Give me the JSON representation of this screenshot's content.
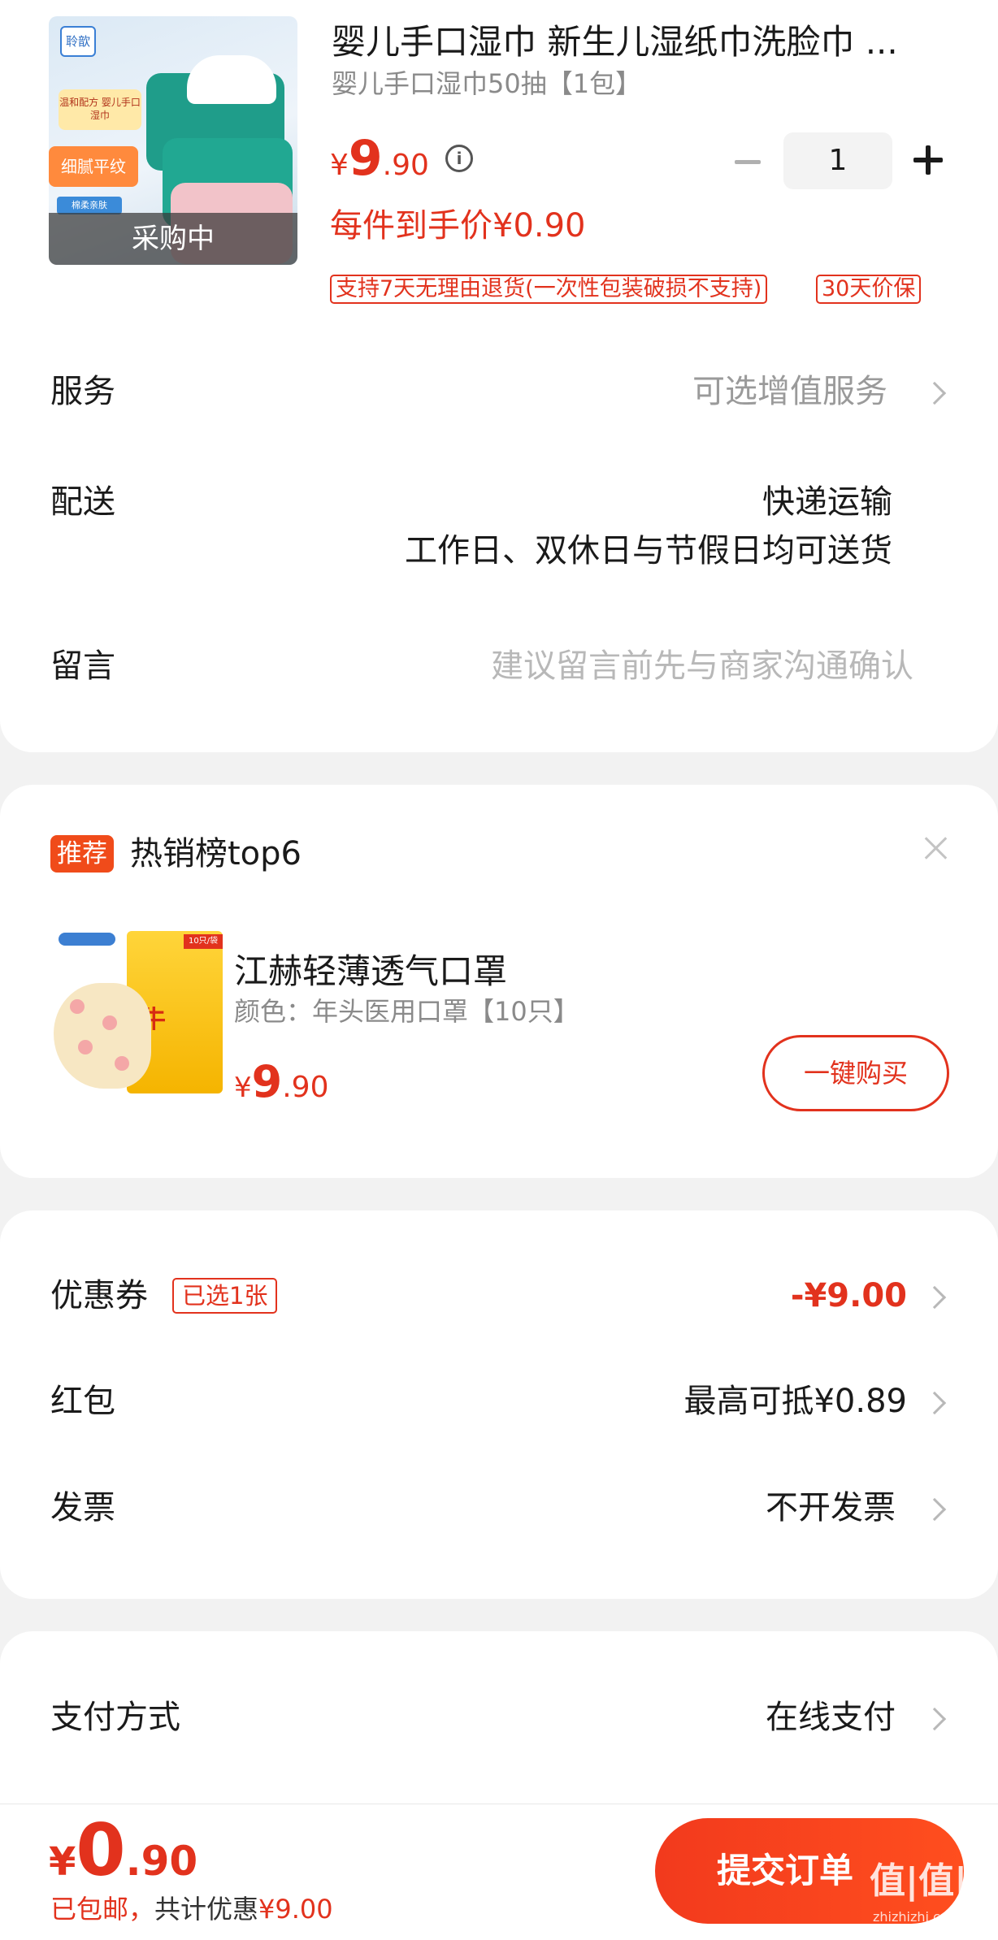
{
  "product": {
    "image_overlay": "采购中",
    "thumb_brand": "聆歆",
    "thumb_tag1": "温和配方 婴儿手口湿巾",
    "thumb_tag2": "细腻平纹",
    "thumb_tag3": "棉柔亲肤",
    "title": "婴儿手口湿巾 新生儿湿纸巾洗脸巾 ...",
    "spec": "婴儿手口湿巾50抽【1包】",
    "price_currency": "¥",
    "price_int": "9",
    "price_dec": ".90",
    "info_icon": "i",
    "quantity": "1",
    "per_item_price": "每件到手价¥0.90",
    "badge_return": "支持7天无理由退货(一次性包装破损不支持)",
    "badge_price_protect": "30天价保"
  },
  "service": {
    "label": "服务",
    "value": "可选增值服务"
  },
  "delivery": {
    "label": "配送",
    "method": "快递运输",
    "note": "工作日、双休日与节假日均可送货"
  },
  "message": {
    "label": "留言",
    "placeholder": "建议留言前先与商家沟通确认"
  },
  "recommend": {
    "tag": "推荐",
    "title": "热销榜top6",
    "bag_text": "牛",
    "bag_label": "10只/袋",
    "item_name": "江赫轻薄透气口罩",
    "item_spec": "颜色：年头医用口罩【10只】",
    "price_currency": "¥",
    "price_int": "9",
    "price_dec": ".90",
    "buy_label": "一键购买"
  },
  "discounts": {
    "coupon_label": "优惠券",
    "coupon_tag": "已选1张",
    "coupon_value": "-¥9.00",
    "redpack_label": "红包",
    "redpack_value": "最高可抵¥0.89",
    "invoice_label": "发票",
    "invoice_value": "不开发票"
  },
  "payment": {
    "label": "支付方式",
    "value": "在线支付"
  },
  "footer": {
    "total_currency": "¥",
    "total_int": "0",
    "total_dec": ".90",
    "shipping": "已包邮，",
    "saving_label": "共计优惠",
    "saving_value": "¥9.00",
    "submit_label": "提交订单",
    "watermark": "值|值|值",
    "watermark_sub": "zhizhizhi.com"
  },
  "colors": {
    "accent": "#e2321d",
    "button": "#f23a1d",
    "background": "#f2f2f2"
  }
}
